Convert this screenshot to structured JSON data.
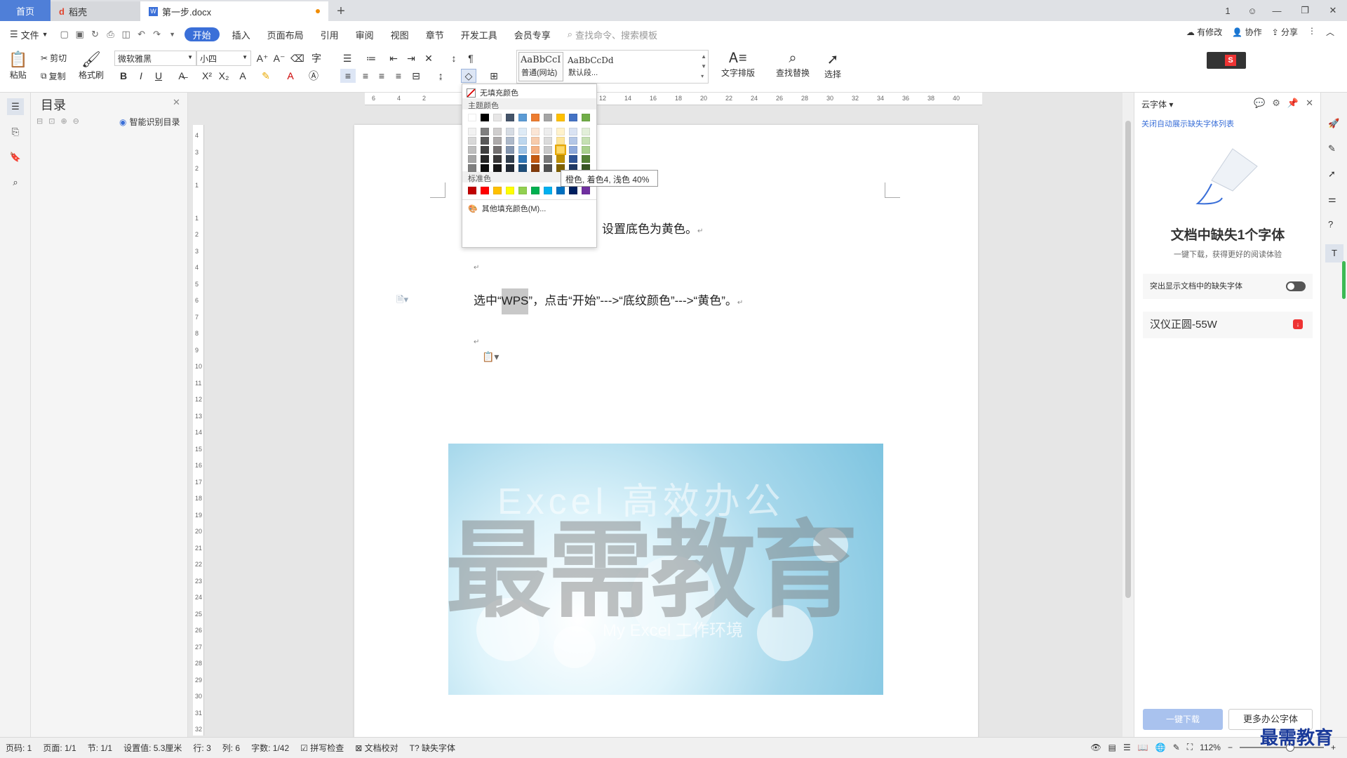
{
  "titlebar": {
    "tab_home": "首页",
    "tab_daoke": "稻壳",
    "tab_doc": "第一步.docx",
    "add": "+",
    "win_buttons": [
      "1",
      "—",
      "❐",
      "✕"
    ]
  },
  "menubar": {
    "file": "文件",
    "items": [
      "开始",
      "插入",
      "页面布局",
      "引用",
      "审阅",
      "视图",
      "章节",
      "开发工具",
      "会员专享"
    ],
    "search_placeholder": "查找命令、搜索模板",
    "right": [
      "有修改",
      "协作",
      "分享"
    ]
  },
  "ribbon": {
    "paste": "粘贴",
    "cut": "剪切",
    "copy": "复制",
    "format_painter": "格式刷",
    "font_name": "微软雅黑",
    "font_size": "小四",
    "style1_preview": "AaBbCcI",
    "style1_name": "普通(网站)",
    "style2_preview": "AaBbCcDd",
    "style2_name": "默认段...",
    "text_layout": "文字排版",
    "find_replace": "查找替换",
    "select": "选择"
  },
  "toc": {
    "title": "目录",
    "smart": "智能识别目录"
  },
  "colorpop": {
    "no_fill": "无填充颜色",
    "theme_title": "主题颜色",
    "standard_title": "标准色",
    "more": "其他填充颜色(M)...",
    "theme_top": [
      "#ffffff",
      "#000000",
      "#e7e6e6",
      "#44546a",
      "#5b9bd5",
      "#ed7d31",
      "#a5a5a5",
      "#ffc000",
      "#4472c4",
      "#70ad47"
    ],
    "theme_cols": [
      [
        "#f2f2f2",
        "#d9d9d9",
        "#bfbfbf",
        "#a6a6a6",
        "#7f7f7f"
      ],
      [
        "#7f7f7f",
        "#595959",
        "#404040",
        "#262626",
        "#0d0d0d"
      ],
      [
        "#d0cece",
        "#aeabab",
        "#757171",
        "#3a3838",
        "#171616"
      ],
      [
        "#d6dce4",
        "#adb9ca",
        "#8496b0",
        "#323f4f",
        "#222a35"
      ],
      [
        "#deebf6",
        "#bdd7ee",
        "#9dc3e6",
        "#2e75b5",
        "#1f4e79"
      ],
      [
        "#fbe5d5",
        "#f7cbac",
        "#f4b183",
        "#c55a11",
        "#833c0b"
      ],
      [
        "#ededed",
        "#dbdbdb",
        "#c9c9c9",
        "#7b7b7b",
        "#525252"
      ],
      [
        "#fff2cc",
        "#fee599",
        "#ffd965",
        "#bf9000",
        "#7f6000"
      ],
      [
        "#dae3f3",
        "#b4c7e7",
        "#8faadc",
        "#2f5496",
        "#1f3864"
      ],
      [
        "#e2efd9",
        "#c5e0b3",
        "#a8d08d",
        "#538135",
        "#375623"
      ]
    ],
    "standard": [
      "#c00000",
      "#ff0000",
      "#ffc000",
      "#ffff00",
      "#92d050",
      "#00b050",
      "#00b0f0",
      "#0070c0",
      "#002060",
      "#7030a0"
    ],
    "tooltip": "橙色, 着色4, 浅色 40%"
  },
  "ruler": {
    "h_ticks": [
      "6",
      "4",
      "2",
      "",
      "2",
      "4",
      "6",
      "8",
      "10",
      "12",
      "14",
      "16",
      "18",
      "20",
      "22",
      "24",
      "26",
      "28",
      "30",
      "32",
      "34",
      "36",
      "38",
      "40"
    ],
    "v_ticks": [
      "4",
      "3",
      "2",
      "1",
      "",
      "1",
      "2",
      "3",
      "4",
      "5",
      "6",
      "7",
      "8",
      "9",
      "10",
      "11",
      "12",
      "13",
      "14",
      "15",
      "16",
      "17",
      "18",
      "19",
      "20",
      "21",
      "22",
      "23",
      "24",
      "25",
      "26",
      "27",
      "28",
      "29",
      "30",
      "31",
      "32"
    ]
  },
  "doc": {
    "line1": "设置底色为黄色。",
    "line2_pre": "选中“",
    "line2_sel": "WPS",
    "line2_post": "”，点击“开始”--->“底纹颜色”--->“黄色”。",
    "watermark_big": "最需教育",
    "watermark_top": "Excel 高效办公",
    "watermark_bottom": "My Excel 工作环境"
  },
  "rightpane": {
    "title": "云字体",
    "link": "关闭自动展示缺失字体列表",
    "heading": "文档中缺失1个字体",
    "sub": "一键下载，获得更好的阅读体验",
    "toggle_label": "突出显示文档中的缺失字体",
    "font_item": "汉仪正圆-55W",
    "btn_download": "一键下载",
    "btn_more": "更多办公字体"
  },
  "statusbar": {
    "items": [
      "页码: 1",
      "页面: 1/1",
      "节: 1/1",
      "设置值: 5.3厘米",
      "行: 3",
      "列: 6",
      "字数: 1/42",
      "拼写检查",
      "文档校对",
      "缺失字体"
    ],
    "zoom": "112%"
  },
  "brand": "最需教育"
}
